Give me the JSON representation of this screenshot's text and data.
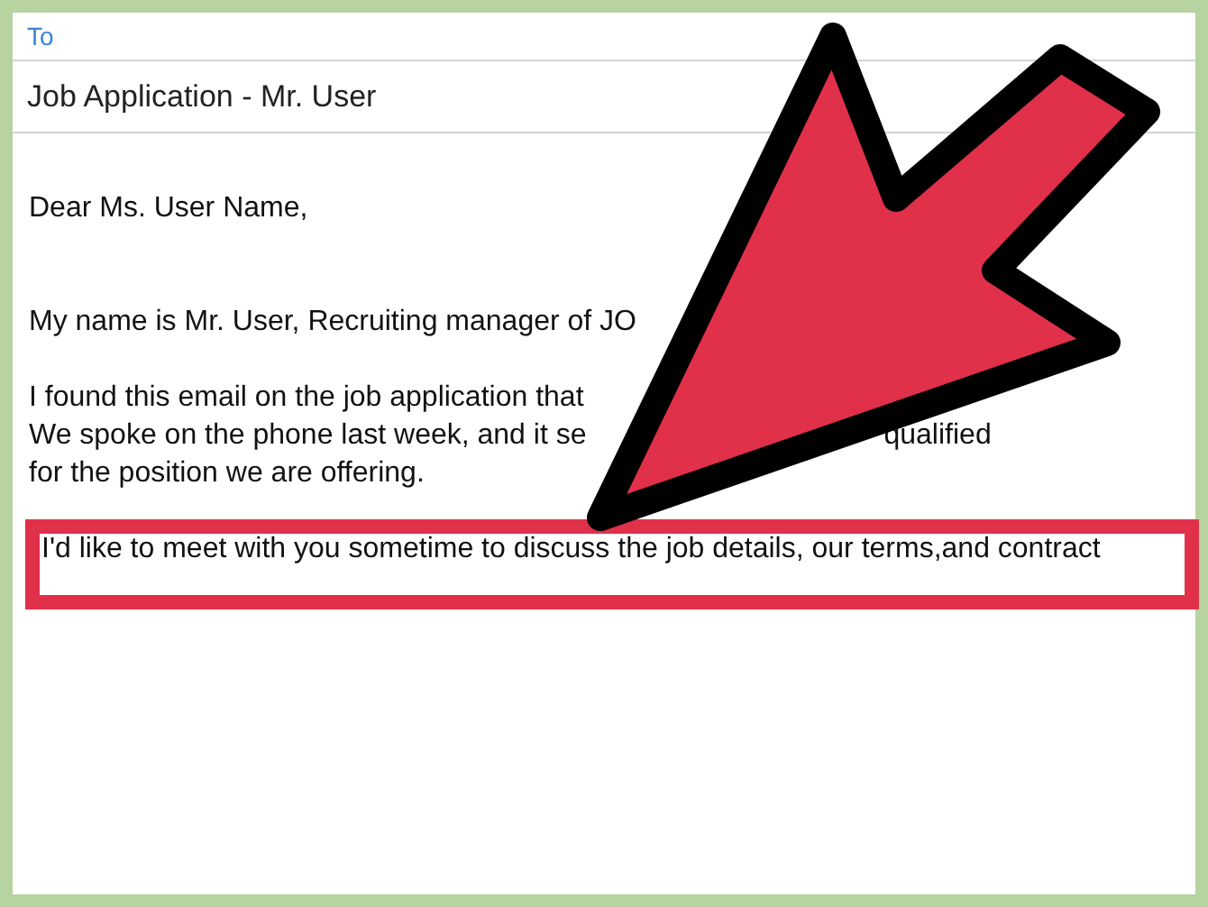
{
  "compose": {
    "to_label": "To",
    "subject": "Job Application - Mr. User"
  },
  "body": {
    "paragraphs": [
      {
        "lines": [
          {
            "segments": [
              "Dear Ms. User Name,"
            ]
          }
        ]
      },
      {
        "lines": [
          {
            "segments": [
              "My name is Mr. User, Recruiting manager of JO"
            ]
          }
        ]
      },
      {
        "lines": [
          {
            "segments": [
              "I found this email on the job application that"
            ]
          },
          {
            "segments": [
              "We spoke on the phone last week, and it se",
              "qualified"
            ]
          },
          {
            "segments": [
              "for the position we are offering."
            ]
          }
        ]
      }
    ],
    "highlighted_line": "I'd like to meet with you sometime to discuss the job details, our terms,and contract"
  }
}
